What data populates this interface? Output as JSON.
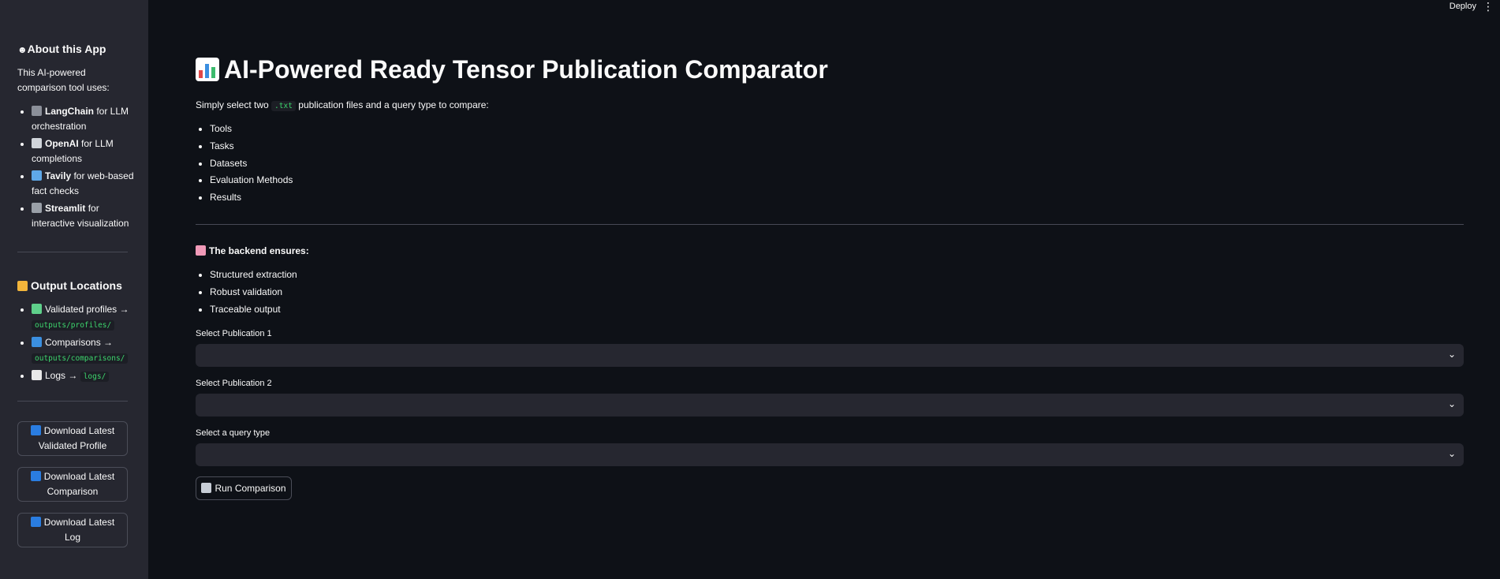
{
  "sidebar": {
    "about_title": "About this App",
    "about_intro": "This AI-powered comparison tool uses:",
    "tools": [
      {
        "icon": "link-icon",
        "name": "LangChain",
        "desc": " for LLM orchestration"
      },
      {
        "icon": "speech-bubble-icon",
        "name": "OpenAI",
        "desc": " for LLM completions"
      },
      {
        "icon": "magnifier-icon",
        "name": "Tavily",
        "desc": " for web-based fact checks"
      },
      {
        "icon": "phone-icon",
        "name": "Streamlit",
        "desc": " for interactive visualization"
      }
    ],
    "output_title": "Output Locations",
    "outputs": {
      "profiles_label": "Validated profiles",
      "profiles_path": "outputs/profiles/",
      "comparisons_label": "Comparisons",
      "comparisons_path": "outputs/comparisons/",
      "logs_label": "Logs",
      "logs_path": "logs/"
    },
    "buttons": {
      "download_profile": "Download Latest Validated Profile",
      "download_comparison": "Download Latest Comparison",
      "download_log": "Download Latest Log"
    }
  },
  "header": {
    "deploy": "Deploy"
  },
  "main": {
    "title": "AI-Powered Ready Tensor Publication Comparator",
    "intro_prefix": "Simply select two",
    "intro_code": ".txt",
    "intro_suffix": "publication files and a query type to compare:",
    "query_items": [
      "Tools",
      "Tasks",
      "Datasets",
      "Evaluation Methods",
      "Results"
    ],
    "backend_title": "The backend ensures:",
    "backend_items": [
      "Structured extraction",
      "Robust validation",
      "Traceable output"
    ],
    "select1_label": "Select Publication 1",
    "select2_label": "Select Publication 2",
    "select3_label": "Select a query type",
    "run_button": "Run Comparison"
  },
  "colors": {
    "background": "#0e1117",
    "sidebar": "#262730",
    "code_text": "#3dd56d"
  }
}
